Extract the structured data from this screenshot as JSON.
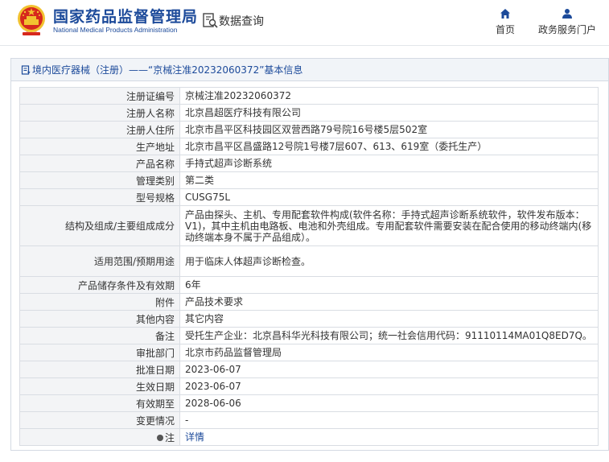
{
  "header": {
    "brand_cn": "国家药品监督管理局",
    "brand_en": "National Medical Products Administration",
    "data_query": "数据查询",
    "nav": [
      {
        "label": "首页",
        "icon": "home-icon"
      },
      {
        "label": "政务服务门户",
        "icon": "user-icon"
      }
    ]
  },
  "panel": {
    "title": "境内医疗器械（注册）——“京械注准20232060372”基本信息"
  },
  "rows": [
    {
      "key": "注册证编号",
      "value": "京械注准20232060372"
    },
    {
      "key": "注册人名称",
      "value": "北京昌超医疗科技有限公司"
    },
    {
      "key": "注册人住所",
      "value": "北京市昌平区科技园区双营西路79号院16号楼5层502室"
    },
    {
      "key": "生产地址",
      "value": "北京市昌平区昌盛路12号院1号楼7层607、613、619室（委托生产）"
    },
    {
      "key": "产品名称",
      "value": "手持式超声诊断系统"
    },
    {
      "key": "管理类别",
      "value": "第二类"
    },
    {
      "key": "型号规格",
      "value": "CUSG75L"
    },
    {
      "key": "结构及组成/主要组成成分",
      "value": "产品由探头、主机、专用配套软件构成(软件名称：手持式超声诊断系统软件，软件发布版本：V1)，其中主机由电路板、电池和外壳组成。专用配套软件需要安装在配合使用的移动终端内(移动终端本身不属于产品组成）。"
    },
    {
      "key": "适用范围/预期用途",
      "value": "用于临床人体超声诊断检查。"
    },
    {
      "key": "产品储存条件及有效期",
      "value": "6年"
    },
    {
      "key": "附件",
      "value": "产品技术要求"
    },
    {
      "key": "其他内容",
      "value": "其它内容"
    },
    {
      "key": "备注",
      "value": "受托生产企业：北京昌科华光科技有限公司；统一社会信用代码：91110114MA01Q8ED7Q。"
    },
    {
      "key": "审批部门",
      "value": "北京市药品监督管理局"
    },
    {
      "key": "批准日期",
      "value": "2023-06-07"
    },
    {
      "key": "生效日期",
      "value": "2023-06-07"
    },
    {
      "key": "有效期至",
      "value": "2028-06-06"
    },
    {
      "key": "变更情况",
      "value": "-"
    },
    {
      "key": "注",
      "value": "详情"
    }
  ],
  "colors": {
    "brand_blue": "#1c4a9a",
    "emblem_red": "#d6281d",
    "emblem_gold": "#f2c230"
  }
}
